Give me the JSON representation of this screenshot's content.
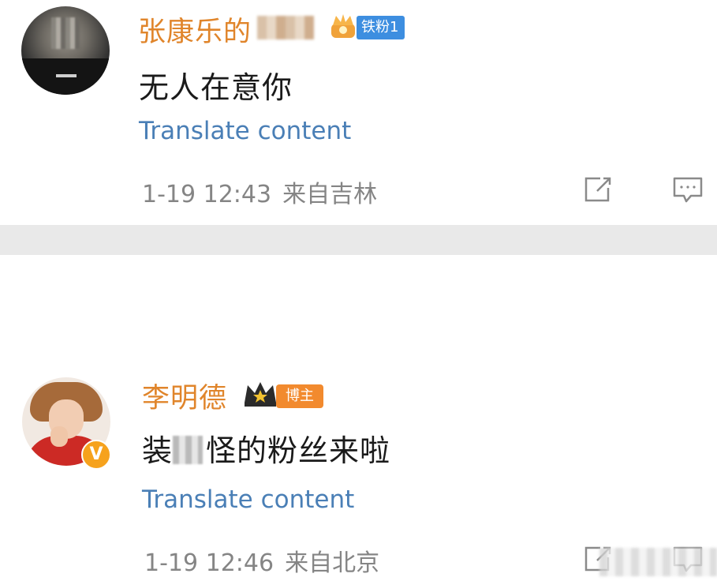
{
  "comments": [
    {
      "username": "张康乐的",
      "badge": "铁粉1",
      "text": "无人在意你",
      "translate_label": "Translate content",
      "date": "1-19 12:43",
      "location": "来自吉林"
    },
    {
      "username": "李明德",
      "badge": "博主",
      "text_masked_prefix": "装",
      "text_rest": "怪的粉丝来啦",
      "translate_label": "Translate content",
      "date": "1-19 12:46",
      "location": "来自北京",
      "avatar_badge": "V"
    }
  ],
  "icons": {
    "fan_badge": "crown-icon",
    "blogger_badge": "crown-icon",
    "share": "share-icon",
    "reply": "comment-icon"
  },
  "colors": {
    "username": "#e0852b",
    "translate_link": "#4a7fb6",
    "meta_text": "#858585",
    "iron_fan_badge": "#3d8ee0",
    "blogger_badge": "#f28a2e",
    "divider": "#e9e9e9"
  }
}
